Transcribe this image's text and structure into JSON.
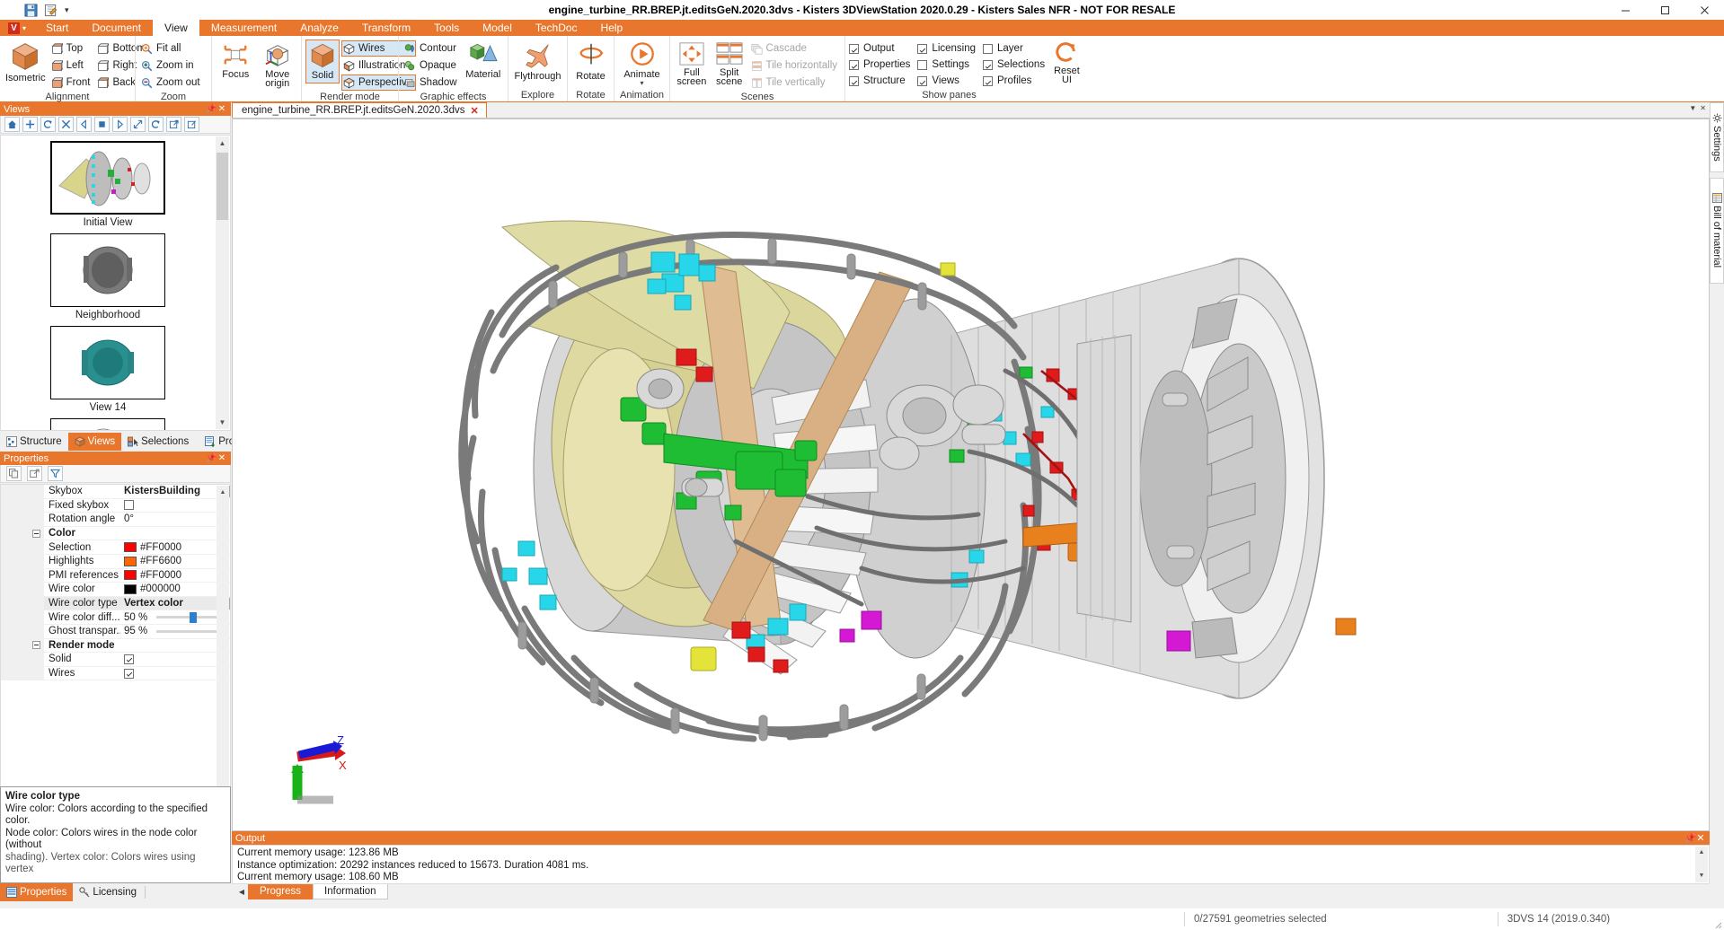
{
  "window": {
    "title": "engine_turbine_RR.BREP.jt.editsGeN.2020.3dvs - Kisters 3DViewStation 2020.0.29 - Kisters Sales NFR - NOT FOR RESALE",
    "minimize": "minimize-icon",
    "maximize": "maximize-icon",
    "close": "close-icon"
  },
  "quick_access": {
    "save": "save-icon",
    "edit": "edit-icon",
    "more": "more-caret-icon"
  },
  "ribbon": {
    "app_button": "V",
    "tabs": [
      {
        "label": "Start",
        "active": false
      },
      {
        "label": "Document",
        "active": false
      },
      {
        "label": "View",
        "active": true
      },
      {
        "label": "Measurement",
        "active": false
      },
      {
        "label": "Analyze",
        "active": false
      },
      {
        "label": "Transform",
        "active": false
      },
      {
        "label": "Tools",
        "active": false
      },
      {
        "label": "Model",
        "active": false
      },
      {
        "label": "TechDoc",
        "active": false
      },
      {
        "label": "Help",
        "active": false
      }
    ],
    "groups": {
      "alignment": {
        "title": "Alignment",
        "big": "Isometric",
        "items": [
          "Top",
          "Left",
          "Front",
          "Bottom",
          "Right",
          "Back"
        ]
      },
      "zoom": {
        "title": "Zoom",
        "items": [
          "Fit all",
          "Zoom in",
          "Zoom out"
        ]
      },
      "focus": {
        "label": "Focus"
      },
      "move_origin": {
        "label": "Move origin"
      },
      "render_mode": {
        "title": "Render mode",
        "big": "Solid",
        "items": [
          {
            "label": "Wires",
            "selected": true
          },
          {
            "label": "Illustration",
            "selected": false
          },
          {
            "label": "Perspective",
            "selected": true
          }
        ]
      },
      "graphic_effects": {
        "title": "Graphic effects",
        "items": [
          "Contour",
          "Opaque",
          "Shadow"
        ],
        "big": "Material"
      },
      "explore": {
        "title": "Explore",
        "big": "Flythrough"
      },
      "rotate": {
        "title": "Rotate",
        "big": "Rotate"
      },
      "animation": {
        "title": "Animation",
        "big": "Animate"
      },
      "scenes": {
        "title": "Scenes",
        "full_screen": "Full screen",
        "split_scene": "Split scene",
        "items": [
          "Cascade",
          "Tile horizontally",
          "Tile vertically"
        ]
      },
      "show_panes": {
        "title": "Show panes",
        "col1": [
          {
            "label": "Output",
            "checked": true
          },
          {
            "label": "Properties",
            "checked": true
          },
          {
            "label": "Structure",
            "checked": true
          }
        ],
        "col2": [
          {
            "label": "Licensing",
            "checked": true
          },
          {
            "label": "Settings",
            "checked": false
          },
          {
            "label": "Views",
            "checked": true
          }
        ],
        "col3": [
          {
            "label": "Layer",
            "checked": false
          },
          {
            "label": "Selections",
            "checked": true
          },
          {
            "label": "Profiles",
            "checked": true
          }
        ],
        "reset_ui": "Reset UI"
      }
    }
  },
  "views_panel": {
    "title": "Views",
    "pin": "pin-icon",
    "close": "close-icon",
    "toolbar": [
      "home-icon",
      "add-icon",
      "refresh-icon",
      "delete-icon",
      "prev-icon",
      "stop-icon",
      "next-icon",
      "expand-icon",
      "update-icon",
      "export-icon",
      "import-icon"
    ],
    "items": [
      {
        "label": "Initial View",
        "selected": true
      },
      {
        "label": "Neighborhood",
        "selected": false
      },
      {
        "label": "View 14",
        "selected": false
      },
      {
        "label": "",
        "selected": false
      }
    ]
  },
  "dock_tabs": [
    {
      "label": "Structure",
      "active": false,
      "icon": "structure-icon"
    },
    {
      "label": "Views",
      "active": true,
      "icon": "views-icon"
    },
    {
      "label": "Selections",
      "active": false,
      "icon": "selections-icon"
    },
    {
      "label": "Profiles",
      "active": false,
      "icon": "profiles-icon"
    }
  ],
  "properties_panel": {
    "title": "Properties",
    "pin": "pin-icon",
    "close": "close-icon",
    "toolbar": [
      "copy-icon",
      "export-icon",
      "filter-icon"
    ],
    "rows": [
      {
        "name": "Skybox",
        "value": "KistersBuilding",
        "type": "combo",
        "bold": true
      },
      {
        "name": "Fixed skybox",
        "value": "",
        "type": "checkbox",
        "checked": false
      },
      {
        "name": "Rotation angle",
        "value": "0°",
        "type": "text"
      },
      {
        "name": "Color",
        "value": "",
        "type": "category"
      },
      {
        "name": "Selection",
        "value": "#FF0000",
        "type": "color",
        "color": "#FF0000"
      },
      {
        "name": "Highlights",
        "value": "#FF6600",
        "type": "color",
        "color": "#FF6600"
      },
      {
        "name": "PMI references",
        "value": "#FF0000",
        "type": "color",
        "color": "#FF0000"
      },
      {
        "name": "Wire color",
        "value": "#000000",
        "type": "color",
        "color": "#000000"
      },
      {
        "name": "Wire color type",
        "value": "Vertex color",
        "type": "text",
        "bold": true,
        "highlight": true
      },
      {
        "name": "Wire color diff...",
        "value": "50 %",
        "type": "slider",
        "percent": 50
      },
      {
        "name": "Ghost transpar...",
        "value": "95 %",
        "type": "slider",
        "percent": 95
      },
      {
        "name": "Render mode",
        "value": "",
        "type": "category"
      },
      {
        "name": "Solid",
        "value": "",
        "type": "checkbox",
        "checked": true
      },
      {
        "name": "Wires",
        "value": "",
        "type": "checkbox",
        "checked": true
      }
    ]
  },
  "tooltip": {
    "title": "Wire color type",
    "line1": "Wire color: Colors according to the specified color.",
    "line2": "Node color: Colors wires in the node color (without",
    "line3": "shading). Vertex color: Colors wires using vertex"
  },
  "bottom_dock_tabs": [
    {
      "label": "Properties",
      "active": true,
      "icon": "properties-icon"
    },
    {
      "label": "Licensing",
      "active": false,
      "icon": "key-icon"
    }
  ],
  "document_tab": {
    "label": "engine_turbine_RR.BREP.jt.editsGeN.2020.3dvs",
    "close": "close-icon"
  },
  "output_panel": {
    "title": "Output",
    "pin": "pin-icon",
    "close": "close-icon",
    "lines": [
      "Current memory usage: 123.86 MB",
      "Instance optimization: 20292 instances reduced to 15673. Duration 4081 ms.",
      "Current memory usage: 108.60 MB"
    ],
    "tabs": [
      {
        "label": "Progress",
        "active": true
      },
      {
        "label": "Information",
        "active": false
      }
    ]
  },
  "right_tabs": [
    {
      "label": "Settings",
      "icon": "gear-icon"
    },
    {
      "label": "Bill of material",
      "icon": "bom-icon"
    }
  ],
  "status_bar": {
    "geometries": "0/27591 geometries selected",
    "version": "3DVS 14 (2019.0.340)"
  },
  "triad": {
    "z": "Z",
    "x": "X"
  },
  "colors": {
    "accent": "#E8762C",
    "selection": "#FF0000",
    "highlight": "#FF6600",
    "wire": "#000000"
  }
}
